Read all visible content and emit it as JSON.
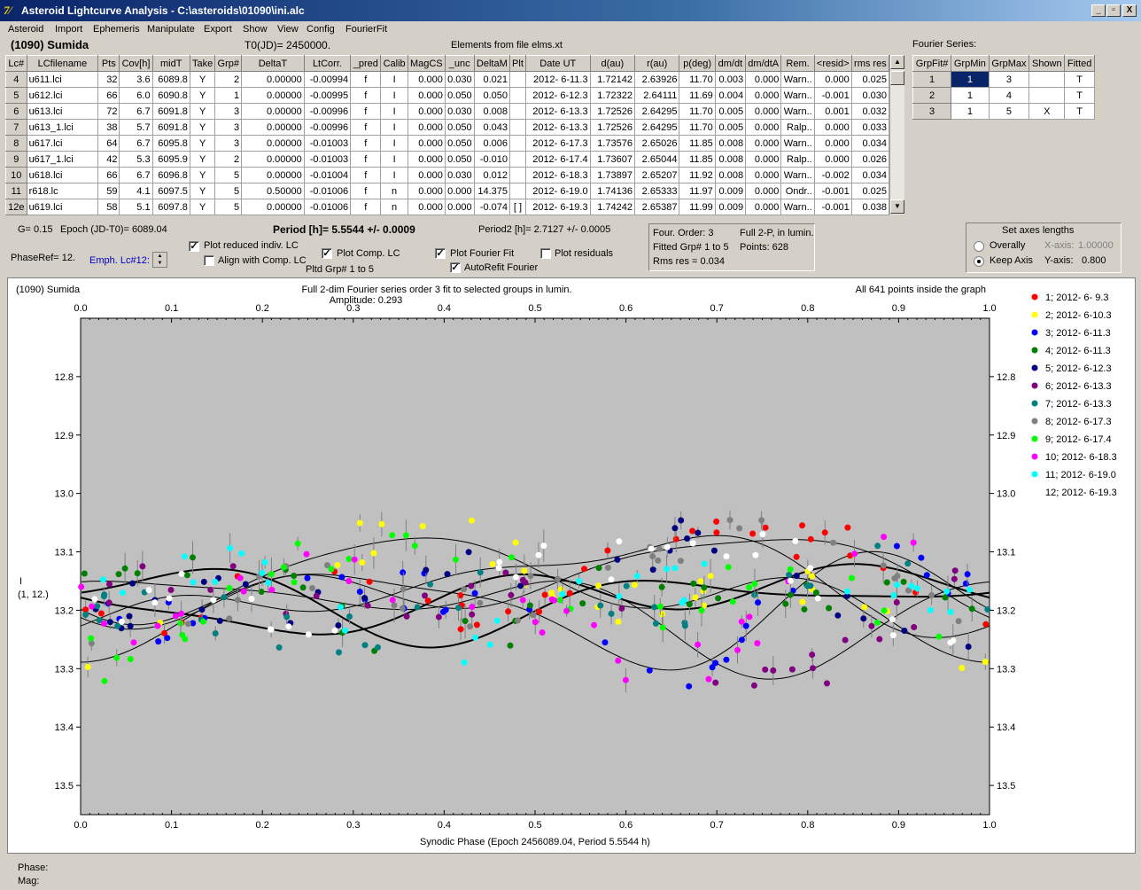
{
  "window": {
    "title": "Asteroid Lightcurve Analysis - C:\\asteroids\\01090\\ini.alc",
    "minimize": "_",
    "restore": "▫",
    "close": "X"
  },
  "menu": [
    "Asteroid",
    "Import",
    "Ephemeris",
    "Manipulate",
    "Export",
    "Show",
    "View",
    "Config",
    "FourierFit"
  ],
  "header": {
    "asteroid": "(1090) Sumida",
    "t0": "T0(JD)= 2450000.",
    "elements": "Elements from file elms.xt",
    "fourier_series": "Fourier Series:"
  },
  "lc_table": {
    "columns": [
      "Lc#",
      "LCfilename",
      "Pts",
      "Cov[h]",
      "midT",
      "Take",
      "Grp#",
      "DeltaT",
      "LtCorr.",
      "_pred",
      "Calib",
      "MagCS",
      "_unc",
      "DeltaM",
      "Plt",
      "Date UT",
      "d(au)",
      "r(au)",
      "p(deg)",
      "dm/dt",
      "dm/dtA",
      "Rem.",
      "<resid>",
      "rms res"
    ],
    "rows": [
      [
        "4",
        "u611.lci",
        "32",
        "3.6",
        "6089.8",
        "Y",
        "2",
        "0.00000",
        "-0.00994",
        "f",
        "I",
        "0.000",
        "0.030",
        "0.021",
        "",
        "2012- 6-11.3",
        "1.72142",
        "2.63926",
        "11.70",
        "0.003",
        "0.000",
        "Warn..",
        "0.000",
        "0.025"
      ],
      [
        "5",
        "u612.lci",
        "66",
        "6.0",
        "6090.8",
        "Y",
        "1",
        "0.00000",
        "-0.00995",
        "f",
        "I",
        "0.000",
        "0.050",
        "0.050",
        "",
        "2012- 6-12.3",
        "1.72322",
        "2.64111",
        "11.69",
        "0.004",
        "0.000",
        "Warn..",
        "-0.001",
        "0.030"
      ],
      [
        "6",
        "u613.lci",
        "72",
        "6.7",
        "6091.8",
        "Y",
        "3",
        "0.00000",
        "-0.00996",
        "f",
        "I",
        "0.000",
        "0.030",
        "0.008",
        "",
        "2012- 6-13.3",
        "1.72526",
        "2.64295",
        "11.70",
        "0.005",
        "0.000",
        "Warn..",
        "0.001",
        "0.032"
      ],
      [
        "7",
        "u613_1.lci",
        "38",
        "5.7",
        "6091.8",
        "Y",
        "3",
        "0.00000",
        "-0.00996",
        "f",
        "I",
        "0.000",
        "0.050",
        "0.043",
        "",
        "2012- 6-13.3",
        "1.72526",
        "2.64295",
        "11.70",
        "0.005",
        "0.000",
        "Ralp..",
        "0.000",
        "0.033"
      ],
      [
        "8",
        "u617.lci",
        "64",
        "6.7",
        "6095.8",
        "Y",
        "3",
        "0.00000",
        "-0.01003",
        "f",
        "I",
        "0.000",
        "0.050",
        "0.006",
        "",
        "2012- 6-17.3",
        "1.73576",
        "2.65026",
        "11.85",
        "0.008",
        "0.000",
        "Warn..",
        "0.000",
        "0.034"
      ],
      [
        "9",
        "u617_1.lci",
        "42",
        "5.3",
        "6095.9",
        "Y",
        "2",
        "0.00000",
        "-0.01003",
        "f",
        "I",
        "0.000",
        "0.050",
        "-0.010",
        "",
        "2012- 6-17.4",
        "1.73607",
        "2.65044",
        "11.85",
        "0.008",
        "0.000",
        "Ralp..",
        "0.000",
        "0.026"
      ],
      [
        "10",
        "u618.lci",
        "66",
        "6.7",
        "6096.8",
        "Y",
        "5",
        "0.00000",
        "-0.01004",
        "f",
        "I",
        "0.000",
        "0.030",
        "0.012",
        "",
        "2012- 6-18.3",
        "1.73897",
        "2.65207",
        "11.92",
        "0.008",
        "0.000",
        "Warn..",
        "-0.002",
        "0.034"
      ],
      [
        "11",
        "r618.lc",
        "59",
        "4.1",
        "6097.5",
        "Y",
        "5",
        "0.50000",
        "-0.01006",
        "f",
        "n",
        "0.000",
        "0.000",
        "14.375",
        "",
        "2012- 6-19.0",
        "1.74136",
        "2.65333",
        "11.97",
        "0.009",
        "0.000",
        "Ondr..",
        "-0.001",
        "0.025"
      ],
      [
        "12e",
        "u619.lci",
        "58",
        "5.1",
        "6097.8",
        "Y",
        "5",
        "0.00000",
        "-0.01006",
        "f",
        "n",
        "0.000",
        "0.000",
        "-0.074",
        "[ ]",
        "2012- 6-19.3",
        "1.74242",
        "2.65387",
        "11.99",
        "0.009",
        "0.000",
        "Warn..",
        "-0.001",
        "0.038"
      ]
    ]
  },
  "fourier_table": {
    "columns": [
      "GrpFit#",
      "GrpMin",
      "GrpMax",
      "Shown",
      "Fitted"
    ],
    "rows": [
      [
        "1",
        "1",
        "3",
        "",
        "T"
      ],
      [
        "2",
        "1",
        "4",
        "",
        "T"
      ],
      [
        "3",
        "1",
        "5",
        "X",
        "T"
      ]
    ]
  },
  "controls": {
    "g": "G= 0.15",
    "epoch": "Epoch (JD-T0)= 6089.04",
    "period": "Period [h]= 5.5544 +/- 0.0009",
    "period2": "Period2 [h]= 2.7127 +/- 0.0005",
    "phase_ref": "PhaseRef= 12.",
    "emph": "Emph. Lc#12:",
    "plot_reduced": "Plot reduced indiv. LC",
    "align_comp": "Align with Comp. LC",
    "plot_comp": "Plot Comp. LC",
    "pltd_grp": "Pltd Grp#  1   to   5",
    "plot_fourier": "Plot Fourier Fit",
    "autorefit": "AutoRefit Fourier",
    "plot_residuals": "Plot residuals",
    "four_order": "Four. Order:  3",
    "full2p": "Full 2-P, in lumin.",
    "fitted_grp": "Fitted Grp# 1 to 5",
    "points": "Points: 628",
    "rms_res": "Rms res     = 0.034",
    "set_axes": "Set axes lengths",
    "overally": "Overally",
    "keep_axis": "Keep Axis",
    "xaxis_label": "X-axis:",
    "xaxis_value": "1.00000",
    "yaxis_label": "Y-axis:",
    "yaxis_value": "0.800"
  },
  "status": {
    "phase": "Phase:",
    "mag": "Mag:"
  },
  "chart_data": {
    "type": "scatter",
    "title_left": "(1090) Sumida",
    "title": "Full 2-dim Fourier series order 3 fit to selected groups in lumin.",
    "subtitle": "Amplitude: 0.293",
    "title_right": "All 641 points inside the graph",
    "xlabel": "Synodic Phase (Epoch 2456089.04, Period 5.5544 h)",
    "ylabel": "I",
    "ylabel2": "(1, 12.)",
    "xlim": [
      0,
      1
    ],
    "ylim": [
      12.7,
      13.55
    ],
    "y_inverted": true,
    "x_ticks": [
      "0.0",
      "0.1",
      "0.2",
      "0.3",
      "0.4",
      "0.5",
      "0.6",
      "0.7",
      "0.8",
      "0.9",
      "1.0"
    ],
    "y_ticks": [
      "12.8",
      "12.9",
      "13.0",
      "13.1",
      "13.2",
      "13.3",
      "13.4",
      "13.5"
    ],
    "background": "#c0c0c0",
    "grid": false,
    "legend_position": "right",
    "series": [
      {
        "name": "1; 2012- 6- 9.3",
        "color": "#ff0000"
      },
      {
        "name": "2; 2012- 6-10.3",
        "color": "#ffff00"
      },
      {
        "name": "3; 2012- 6-11.3",
        "color": "#0000ff"
      },
      {
        "name": "4; 2012- 6-11.3",
        "color": "#008000"
      },
      {
        "name": "5; 2012- 6-12.3",
        "color": "#000080"
      },
      {
        "name": "6; 2012- 6-13.3",
        "color": "#800080"
      },
      {
        "name": "7; 2012- 6-13.3",
        "color": "#008080"
      },
      {
        "name": "8; 2012- 6-17.3",
        "color": "#808080"
      },
      {
        "name": "9; 2012- 6-17.4",
        "color": "#00ff00"
      },
      {
        "name": "10; 2012- 6-18.3",
        "color": "#ff00ff"
      },
      {
        "name": "11; 2012- 6-19.0",
        "color": "#00ffff"
      },
      {
        "name": "12; 2012- 6-19.3",
        "color": "#ffffff"
      }
    ],
    "fit_curves": [
      {
        "name": "fit-1",
        "mean": 13.15,
        "terms": [
          [
            1,
            0.05,
            0.3
          ],
          [
            2,
            0.04,
            1.5
          ],
          [
            3,
            0.02,
            0.4
          ]
        ],
        "width": 1
      },
      {
        "name": "fit-2",
        "mean": 13.17,
        "terms": [
          [
            1,
            0.07,
            2.0
          ],
          [
            2,
            0.05,
            0.9
          ],
          [
            3,
            0.02,
            2.2
          ]
        ],
        "width": 1
      },
      {
        "name": "fit-3",
        "mean": 13.19,
        "terms": [
          [
            1,
            0.04,
            4.0
          ],
          [
            2,
            0.06,
            0.2
          ],
          [
            3,
            0.03,
            1.1
          ]
        ],
        "width": 1
      },
      {
        "name": "fit-4",
        "mean": 13.18,
        "terms": [
          [
            1,
            0.03,
            5.2
          ],
          [
            2,
            0.04,
            3.0
          ],
          [
            3,
            0.015,
            0.8
          ]
        ],
        "width": 2
      },
      {
        "name": "fit-5",
        "mean": 13.16,
        "terms": [
          [
            1,
            0.06,
            1.0
          ],
          [
            2,
            0.03,
            2.6
          ],
          [
            3,
            0.025,
            3.1
          ]
        ],
        "width": 1
      },
      {
        "name": "fit-6",
        "mean": 13.2,
        "terms": [
          [
            1,
            0.05,
            3.2
          ],
          [
            2,
            0.05,
            4.4
          ],
          [
            3,
            0.02,
            0.1
          ]
        ],
        "width": 1
      },
      {
        "name": "fit-7",
        "mean": 13.18,
        "terms": [
          [
            1,
            0.035,
            0.0
          ],
          [
            2,
            0.03,
            5.5
          ],
          [
            3,
            0.02,
            1.8
          ]
        ],
        "width": 2
      }
    ]
  }
}
